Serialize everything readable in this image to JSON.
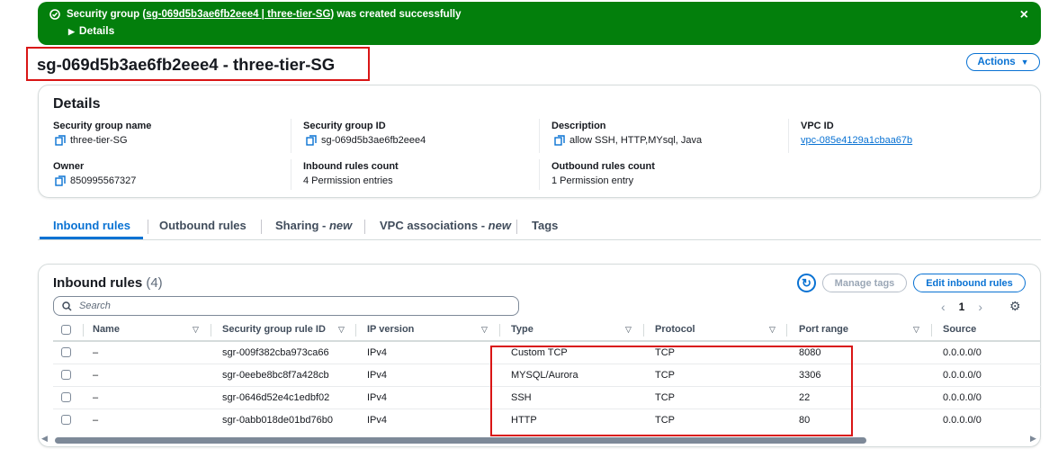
{
  "flash": {
    "prefix": "Security group (",
    "link": "sg-069d5b3ae6fb2eee4 | three-tier-SG",
    "suffix": ") was created successfully",
    "details_label": "Details",
    "close_icon": "×"
  },
  "page": {
    "title": "sg-069d5b3ae6fb2eee4 - three-tier-SG",
    "actions_label": "Actions",
    "actions_caret": "▼"
  },
  "details": {
    "heading": "Details",
    "sg_name_label": "Security group name",
    "sg_name_value": "three-tier-SG",
    "sg_id_label": "Security group ID",
    "sg_id_value": "sg-069d5b3ae6fb2eee4",
    "description_label": "Description",
    "description_value": "allow SSH, HTTP,MYsql, Java",
    "vpc_label": "VPC ID",
    "vpc_value": "vpc-085e4129a1cbaa67b",
    "owner_label": "Owner",
    "owner_value": "850995567327",
    "inbound_count_label": "Inbound rules count",
    "inbound_count_value": "4 Permission entries",
    "outbound_count_label": "Outbound rules count",
    "outbound_count_value": "1 Permission entry"
  },
  "tabs": {
    "inbound": "Inbound rules",
    "outbound": "Outbound rules",
    "sharing": "Sharing - ",
    "sharing_new": "new",
    "vpc_assoc": "VPC associations - ",
    "vpc_assoc_new": "new",
    "tags": "Tags"
  },
  "inbound": {
    "title": "Inbound rules",
    "count": "(4)",
    "manage_tags": "Manage tags",
    "edit_label": "Edit inbound rules",
    "search_placeholder": "Search",
    "page_number": "1",
    "columns": [
      "Name",
      "Security group rule ID",
      "IP version",
      "Type",
      "Protocol",
      "Port range",
      "Source"
    ],
    "rows": [
      {
        "name": "–",
        "rule_id": "sgr-009f382cba973ca66",
        "ip": "IPv4",
        "type": "Custom TCP",
        "protocol": "TCP",
        "port": "8080",
        "source": "0.0.0.0/0"
      },
      {
        "name": "–",
        "rule_id": "sgr-0eebe8bc8f7a428cb",
        "ip": "IPv4",
        "type": "MYSQL/Aurora",
        "protocol": "TCP",
        "port": "3306",
        "source": "0.0.0.0/0"
      },
      {
        "name": "–",
        "rule_id": "sgr-0646d52e4c1edbf02",
        "ip": "IPv4",
        "type": "SSH",
        "protocol": "TCP",
        "port": "22",
        "source": "0.0.0.0/0"
      },
      {
        "name": "–",
        "rule_id": "sgr-0abb018de01bd76b0",
        "ip": "IPv4",
        "type": "HTTP",
        "protocol": "TCP",
        "port": "80",
        "source": "0.0.0.0/0"
      }
    ]
  },
  "colors": {
    "success": "#037f0c",
    "link": "#0972d3",
    "highlight": "#d91515"
  }
}
